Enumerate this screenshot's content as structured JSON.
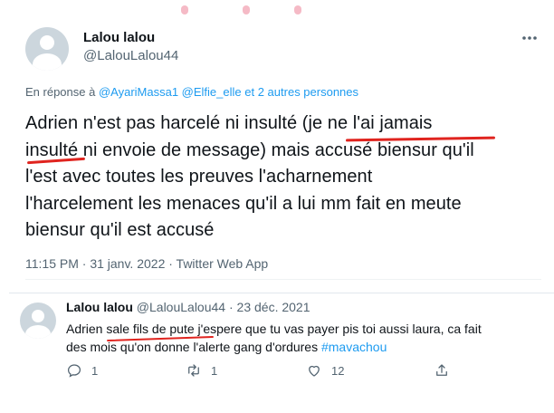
{
  "tweet": {
    "author_name": "Lalou lalou",
    "handle": "@LalouLalou44",
    "more_icon": "more-icon",
    "reply_prefix": "En réponse à",
    "reply_mentions": "@AyariMassa1 @Elfie_elle",
    "reply_others": "et 2 autres personnes",
    "text_lines": [
      "Adrien n'est pas harcelé ni insulté (je ne l'ai jamais",
      "insulté ni envoie de message) mais accusé biensur qu'il",
      "l'est avec toutes les preuves l'acharnement",
      "l'harcelement les menaces qu'il a lui mm fait en meute",
      "biensur qu'il est accusé"
    ],
    "timestamp": "11:15 PM · 31 janv. 2022 · Twitter Web App"
  },
  "quoted": {
    "author_name": "Lalou lalou",
    "handle": "@LalouLalou44",
    "dot": "·",
    "date": "23 déc. 2021",
    "text_line1": "Adrien sale fils de pute j'espere que tu vas payer pis toi aussi laura, ca fait",
    "text_line2_prefix": "des mois qu'on donne l'alerte gang d'ordures",
    "hashtag": "#mavachou",
    "actions": {
      "reply_count": "1",
      "retweet_count": "1",
      "like_count": "12"
    }
  },
  "colors": {
    "link": "#1d9bf0",
    "secondary": "#536471",
    "underline_marker": "#e0241f"
  }
}
